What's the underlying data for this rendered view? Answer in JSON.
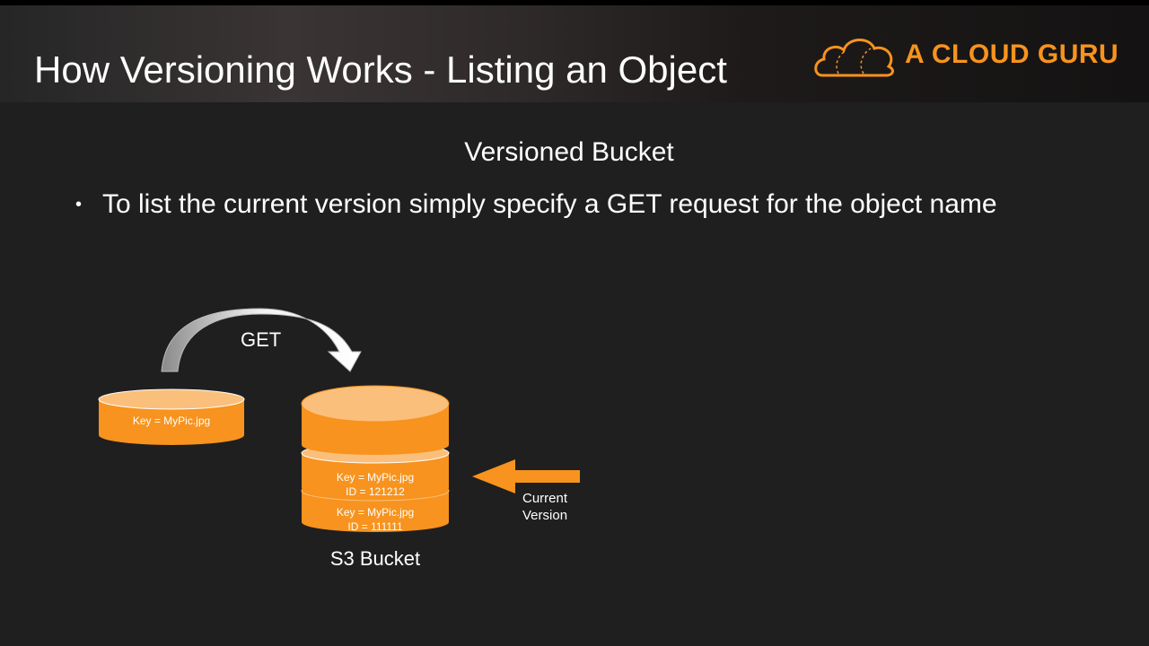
{
  "slide": {
    "title": "How Versioning Works - Listing an Object",
    "subtitle": "Versioned Bucket",
    "bullets": [
      "To list the current version simply specify a GET request for the object name"
    ]
  },
  "brand": {
    "name": "A CLOUD GURU",
    "color": "#f7931e"
  },
  "diagram": {
    "request_label": "GET",
    "source_object": {
      "key": "Key = MyPic.jpg"
    },
    "bucket_label": "S3 Bucket",
    "versions": [
      {
        "key": "Key = MyPic.jpg",
        "id": "ID = 121212"
      },
      {
        "key": "Key = MyPic.jpg",
        "id": "ID = 111111"
      }
    ],
    "pointer_label_line1": "Current",
    "pointer_label_line2": "Version",
    "colors": {
      "object": "#f7931e",
      "object_top": "#fbbf7c",
      "arrow": "#f7931e"
    }
  }
}
